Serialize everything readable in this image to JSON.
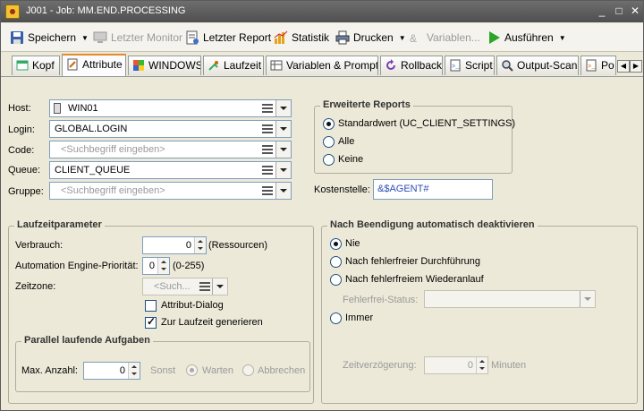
{
  "window": {
    "title": "J001 - Job: MM.END.PROCESSING",
    "controls": [
      "_",
      "□",
      "✕"
    ]
  },
  "toolbar": {
    "save": "Speichern",
    "last_monitor": "Letzter Monitor",
    "last_report": "Letzter Report",
    "statistics": "Statistik",
    "print": "Drucken",
    "variables": "Variablen...",
    "execute": "Ausführen"
  },
  "tabs": [
    {
      "label": "Kopf"
    },
    {
      "label": "Attribute"
    },
    {
      "label": "WINDOWS"
    },
    {
      "label": "Laufzeit"
    },
    {
      "label": "Variablen & Prompts"
    },
    {
      "label": "Rollback"
    },
    {
      "label": "Script"
    },
    {
      "label": "Output-Scan"
    },
    {
      "label": "Po"
    }
  ],
  "active_tab": "Attribute",
  "host_section": {
    "host_label": "Host:",
    "host_value": "WIN01",
    "login_label": "Login:",
    "login_value": "GLOBAL.LOGIN",
    "code_label": "Code:",
    "code_placeholder": "<Suchbegriff eingeben>",
    "queue_label": "Queue:",
    "queue_value": "CLIENT_QUEUE",
    "group_label": "Gruppe:",
    "group_placeholder": "<Suchbegriff eingeben>"
  },
  "reports": {
    "title": "Erweiterte Reports",
    "options": [
      "Standardwert (UC_CLIENT_SETTINGS)",
      "Alle",
      "Keine"
    ],
    "selected": "Standardwert (UC_CLIENT_SETTINGS)"
  },
  "cost": {
    "label": "Kostenstelle:",
    "value": "&$AGENT#"
  },
  "runtime": {
    "title": "Laufzeitparameter",
    "usage_label": "Verbrauch:",
    "usage_value": "0",
    "usage_unit": "(Ressourcen)",
    "priority_label": "Automation Engine-Priorität:",
    "priority_value": "0",
    "priority_range": "(0-255)",
    "timezone_label": "Zeitzone:",
    "timezone_placeholder": "<Such...",
    "attr_dialog_label": "Attribut-Dialog",
    "attr_dialog_checked": false,
    "gen_runtime_label": "Zur Laufzeit generieren",
    "gen_runtime_checked": true
  },
  "parallel": {
    "title": "Parallel laufende Aufgaben",
    "max_label": "Max. Anzahl:",
    "max_value": "0",
    "else_label": "Sonst",
    "wait_label": "Warten",
    "abort_label": "Abbrechen",
    "selected": "Warten"
  },
  "deactivate": {
    "title": "Nach Beendigung automatisch deaktivieren",
    "options": [
      "Nie",
      "Nach fehlerfreier Durchführung",
      "Nach fehlerfreiem Wiederanlauf",
      "Immer"
    ],
    "selected": "Nie",
    "error_free_label": "Fehlerfrei-Status:",
    "delay_label": "Zeitverzögerung:",
    "delay_value": "0",
    "delay_unit": "Minuten"
  },
  "colors": {
    "accent": "#e68b2c",
    "titlebar": "#5a5a5a",
    "panel": "#ece9d8",
    "cost_value": "#2a4fb8"
  }
}
